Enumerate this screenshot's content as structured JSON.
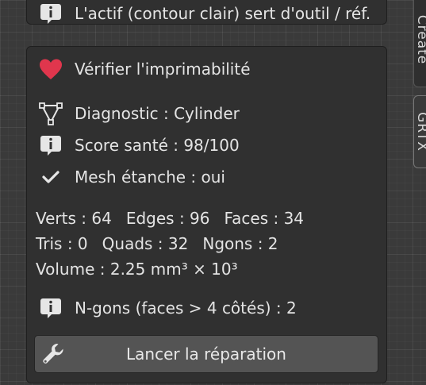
{
  "side_tabs": {
    "create": "Create",
    "grtx": "GRTX"
  },
  "top_panel": {
    "text": "L'actif (contour clair) sert d'outil / réf.",
    "icon": "info-icon"
  },
  "main_panel": {
    "title": "Vérifier l'imprimabilité",
    "title_icon": "heart-icon",
    "diagnostic": "Diagnostic : Cylinder",
    "diagnostic_icon": "mesh-triangle-icon",
    "score": "Score santé : 98/100",
    "score_icon": "info-icon",
    "watertight": "Mesh étanche : oui",
    "watertight_icon": "checkmark-icon",
    "stats": {
      "verts": "Verts : 64",
      "edges": "Edges : 96",
      "faces": "Faces : 34",
      "tris": "Tris : 0",
      "quads": "Quads : 32",
      "ngons": "Ngons : 2",
      "volume": "Volume : 2.25 mm³ × 10³"
    },
    "ngons_info": "N-gons (faces > 4 côtés) : 2",
    "ngons_icon": "info-icon",
    "repair_button": "Lancer la réparation",
    "repair_icon": "wrench-icon"
  },
  "colors": {
    "heart": "#e0364d",
    "panel_bg": "#303030",
    "button_bg": "#545454"
  }
}
